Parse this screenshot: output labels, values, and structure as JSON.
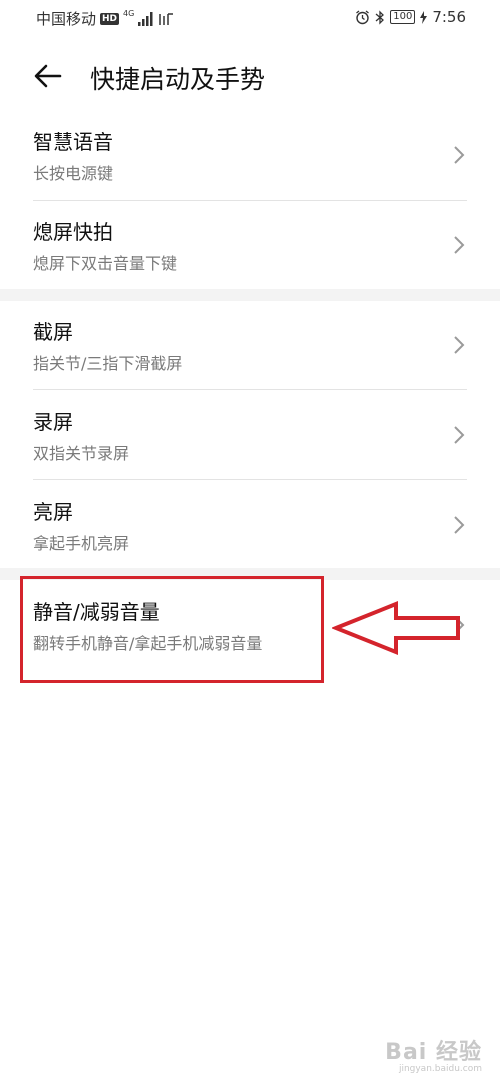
{
  "status_bar": {
    "carrier": "中国移动",
    "hd_badge": "HD",
    "network_type": "4G",
    "battery": "100",
    "time": "7:56"
  },
  "header": {
    "title": "快捷启动及手势"
  },
  "sections": [
    {
      "items": [
        {
          "label": "智慧语音",
          "desc": "长按电源键"
        },
        {
          "label": "熄屏快拍",
          "desc": "熄屏下双击音量下键"
        }
      ]
    },
    {
      "items": [
        {
          "label": "截屏",
          "desc": "指关节/三指下滑截屏"
        },
        {
          "label": "录屏",
          "desc": "双指关节录屏"
        },
        {
          "label": "亮屏",
          "desc": "拿起手机亮屏"
        }
      ]
    },
    {
      "items": [
        {
          "label": "静音/减弱音量",
          "desc": "翻转手机静音/拿起手机减弱音量"
        }
      ]
    }
  ],
  "annotation": {
    "color": "#d4242c"
  },
  "watermark": {
    "main": "Bai 经验",
    "sub": "jingyan.baidu.com"
  }
}
